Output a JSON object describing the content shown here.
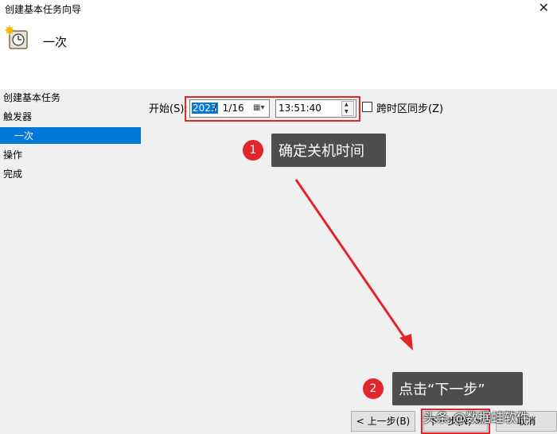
{
  "window": {
    "title": "创建基本任务向导",
    "close_glyph": "✕"
  },
  "header": {
    "page_heading": "一次",
    "icon": "clock-icon"
  },
  "nav": {
    "items": [
      "创建基本任务",
      "触发器",
      "一次",
      "操作",
      "完成"
    ]
  },
  "form": {
    "start_label": "开始(S):",
    "date_year": "2023",
    "date_rest": "/  1/16",
    "time_value": "13:51:40",
    "sync_timezone_label": "跨时区同步(Z)",
    "sync_timezone_checked": false
  },
  "annotations": {
    "step1_number": "1",
    "step1_text": "确定关机时间",
    "step2_number": "2",
    "step2_text": "点击“下一步”"
  },
  "buttons": {
    "back": "< 上一步(B)",
    "next": "下一步(N) >",
    "cancel": "取消"
  },
  "watermark": "头条 @数据蛙软件",
  "colors": {
    "accent": "#0078d7",
    "annotation_red": "#e0262b",
    "callout_bg": "#4d4d4d"
  }
}
